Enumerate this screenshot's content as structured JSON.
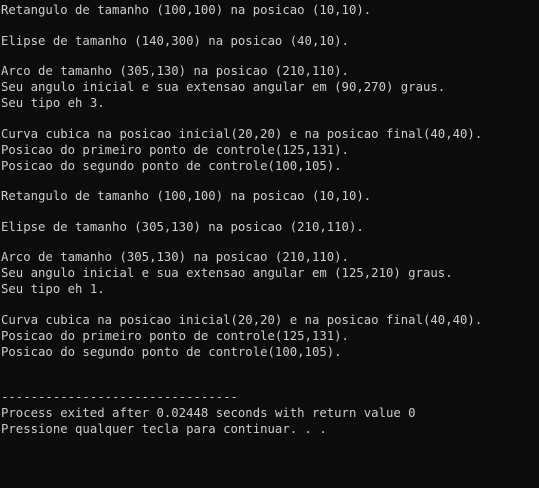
{
  "console": {
    "lines": [
      "Retangulo de tamanho (100,100) na posicao (10,10).",
      "",
      "Elipse de tamanho (140,300) na posicao (40,10).",
      "",
      "Arco de tamanho (305,130) na posicao (210,110).",
      "Seu angulo inicial e sua extensao angular em (90,270) graus.",
      "Seu tipo eh 3.",
      "",
      "Curva cubica na posicao inicial(20,20) e na posicao final(40,40).",
      "Posicao do primeiro ponto de controle(125,131).",
      "Posicao do segundo ponto de controle(100,105).",
      "",
      "Retangulo de tamanho (100,100) na posicao (10,10).",
      "",
      "Elipse de tamanho (305,130) na posicao (210,110).",
      "",
      "Arco de tamanho (305,130) na posicao (210,110).",
      "Seu angulo inicial e sua extensao angular em (125,210) graus.",
      "Seu tipo eh 1.",
      "",
      "Curva cubica na posicao inicial(20,20) e na posicao final(40,40).",
      "Posicao do primeiro ponto de controle(125,131).",
      "Posicao do segundo ponto de controle(100,105).",
      "",
      "",
      "--------------------------------",
      "Process exited after 0.02448 seconds with return value 0",
      "Pressione qualquer tecla para continuar. . ."
    ]
  }
}
